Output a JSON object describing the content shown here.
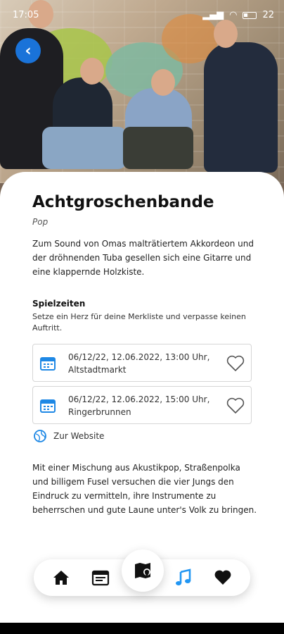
{
  "status_bar": {
    "time": "17:05",
    "battery": "22"
  },
  "band": {
    "name": "Achtgroschenbande",
    "genre": "Pop",
    "description": "Zum Sound von Omas malträtiertem Akkordeon und der dröhnenden Tuba gesellen sich eine Gitarre und eine klappernde Holzkiste."
  },
  "schedule": {
    "title": "Spielzeiten",
    "subtitle": "Setze ein Herz für deine Merkliste und verpasse keinen Auftritt.",
    "events": [
      {
        "line1": "06/12/22, 12.06.2022, 13:00 Uhr,",
        "line2": "Altstadtmarkt"
      },
      {
        "line1": "06/12/22, 12.06.2022, 15:00 Uhr,",
        "line2": "Ringerbrunnen"
      }
    ]
  },
  "website_label": "Zur Website",
  "long_text": "Mit einer Mischung aus Akustikpop, Straßenpolka und billigem Fusel versuchen die vier Jungs den Eindruck zu vermitteln, ihre Instrumente zu beherrschen und gute Laune unter's Volk zu bringen.",
  "nav": {
    "items": [
      {
        "icon": "home-icon"
      },
      {
        "icon": "calendar-news-icon"
      },
      {
        "icon": "map-icon"
      },
      {
        "icon": "music-icon"
      },
      {
        "icon": "heart-icon"
      }
    ],
    "active_color": "#2196f3"
  },
  "colors": {
    "accent": "#1a73d9",
    "icon_blue": "#1e88e5"
  }
}
